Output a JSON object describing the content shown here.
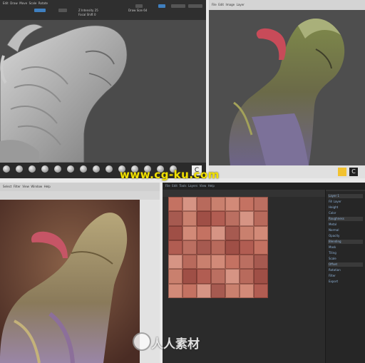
{
  "watermark": {
    "url": "www.cg-ku.com",
    "brand": "人人素材"
  },
  "zbrush": {
    "app_icon_label": "C",
    "menu_items": [
      "Edit",
      "Draw",
      "Move",
      "Scale",
      "Rotate"
    ],
    "sliders": [
      "Z Intensity 25",
      "Focal Shift 0",
      "Draw Size 64"
    ],
    "brush_count": 14
  },
  "photoshop": {
    "taskbar_icon_label": "C",
    "menu_items": [
      "File",
      "Edit",
      "Image",
      "Layer",
      "Select",
      "Filter",
      "View",
      "Window",
      "Help"
    ]
  },
  "texture_tool": {
    "menu_items": [
      "File",
      "Edit",
      "Tools",
      "Layers",
      "View",
      "Help"
    ],
    "right_panel_rows": [
      "Layer 1",
      "Fill Layer",
      "Height",
      "Color",
      "Roughness",
      "Metal",
      "Normal",
      "Opacity",
      "Blending",
      "Mask",
      "Tiling",
      "Scale",
      "Offset",
      "Rotation",
      "Filter",
      "Export"
    ]
  },
  "colors": {
    "page_bg": "#e9e9e9",
    "zbrush_bg": "#3a3a3a",
    "viewport_gray": "#505050",
    "texture_bg": "#2b2b2b",
    "watermark_yellow": "#f0e000",
    "accent_blue": "#3f7fbf"
  }
}
